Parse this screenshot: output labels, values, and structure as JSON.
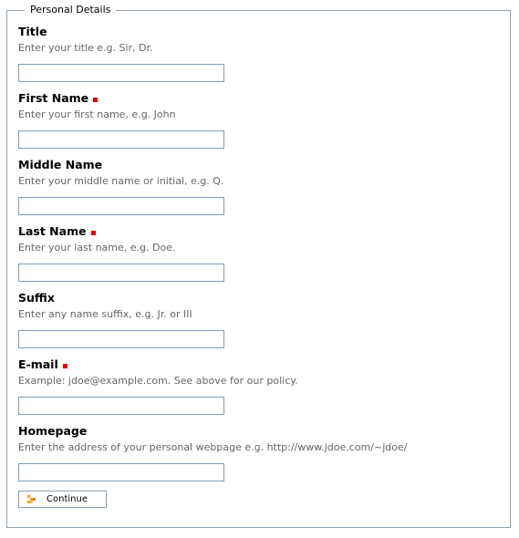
{
  "form": {
    "legend": "Personal Details",
    "required_color": "#e00000",
    "fields": [
      {
        "label": "Title",
        "hint": "Enter your title e.g. Sir, Dr.",
        "required": false,
        "value": ""
      },
      {
        "label": "First Name",
        "hint": "Enter your first name, e.g. John",
        "required": true,
        "value": ""
      },
      {
        "label": "Middle Name",
        "hint": "Enter your middle name or initial, e.g. Q.",
        "required": false,
        "value": ""
      },
      {
        "label": "Last Name",
        "hint": "Enter your last name, e.g. Doe.",
        "required": true,
        "value": ""
      },
      {
        "label": "Suffix",
        "hint": "Enter any name suffix, e.g. Jr. or III",
        "required": false,
        "value": ""
      },
      {
        "label": "E-mail",
        "hint": "Example: jdoe@example.com. See above for our policy.",
        "required": true,
        "value": ""
      },
      {
        "label": "Homepage",
        "hint": "Enter the address of your personal webpage e.g. http://www.jdoe.com/~jdoe/",
        "required": false,
        "value": ""
      }
    ],
    "submit": {
      "label": "Continue",
      "icon": "arrow-icon"
    }
  }
}
